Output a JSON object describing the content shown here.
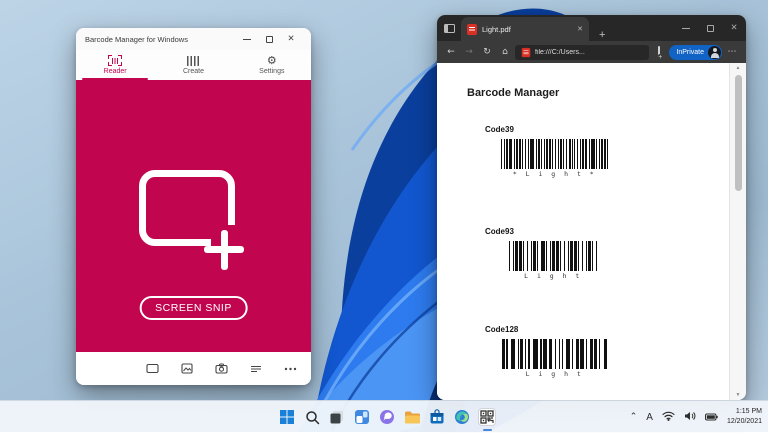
{
  "app_window": {
    "title": "Barcode Manager for Windows",
    "controls": {
      "minimize": "minimize",
      "maximize": "maximize",
      "close": "✕"
    },
    "accent_color": "#c1054f",
    "tabs": [
      {
        "label": "Reader",
        "icon": "barcode-scan-icon",
        "active": true
      },
      {
        "label": "Create",
        "icon": "barcode-icon",
        "active": false
      },
      {
        "label": "Settings",
        "icon": "gear-icon",
        "active": false
      }
    ],
    "snip_button_label": "SCREEN SNIP",
    "toolbar_icons": [
      "screen-snip-icon",
      "image-file-icon",
      "camera-icon",
      "history-list-icon",
      "more-icon"
    ]
  },
  "browser": {
    "tab_title": "Light.pdf",
    "tab_close": "✕",
    "new_tab": "+",
    "nav": {
      "back": "←",
      "forward": "→",
      "refresh": "↻",
      "home": "⌂",
      "more": "⋯"
    },
    "address": "file:///C:/Users...",
    "inprivate_label": "InPrivate",
    "controls": {
      "close": "✕"
    },
    "pdf": {
      "heading": "Barcode Manager",
      "barcodes": [
        {
          "type": "Code39",
          "text": "* L i g h t *",
          "pattern": "1211212112112121121211212211211211212122121121121221121212112122112121121121211"
        },
        {
          "type": "Code93",
          "text": "L i g h t",
          "pattern": "1211212112121121123112112121121211212112121121121"
        },
        {
          "type": "Code128",
          "text": "L i g h t",
          "pattern": "211232112111223211312212111231122131122121132"
        }
      ],
      "scroll_up": "▲",
      "scroll_down": "▼"
    }
  },
  "taskbar": {
    "items": [
      "start",
      "search",
      "task-view",
      "widgets",
      "chat",
      "file-explorer",
      "store",
      "edge",
      "barcode-manager"
    ],
    "active_item": "barcode-manager",
    "tray": {
      "chevron": "⌃",
      "ime": "A",
      "icons": [
        "wifi-icon",
        "volume-icon",
        "battery-icon"
      ]
    },
    "time": "1:15 PM",
    "date": "12/20/2021"
  },
  "colors": {
    "bloom_blue": "#1257d0",
    "taskbar_bg": "#f1f6fb",
    "edge_dark": "#272727",
    "inprivate_blue": "#1263c6"
  }
}
